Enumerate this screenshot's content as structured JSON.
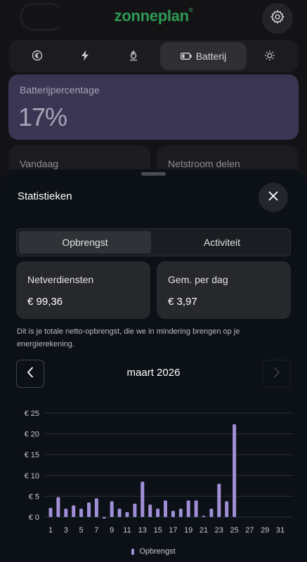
{
  "app": {
    "brand": "zonneplan",
    "brand_mark": "®"
  },
  "header": {
    "settings_icon": "gear-icon"
  },
  "tabs": [
    {
      "icon": "euro-icon",
      "label": ""
    },
    {
      "icon": "lightning-icon",
      "label": ""
    },
    {
      "icon": "flame-icon",
      "label": ""
    },
    {
      "icon": "battery-icon",
      "label": "Batterij",
      "active": true
    },
    {
      "icon": "sun-icon",
      "label": ""
    }
  ],
  "battery": {
    "label": "Batterijpercentage",
    "value": "17%"
  },
  "cards": {
    "today": "Vandaag",
    "netstroom": "Netstroom delen"
  },
  "sheet": {
    "title": "Statistieken",
    "segments": [
      {
        "label": "Opbrengst",
        "active": true
      },
      {
        "label": "Activiteit",
        "active": false
      }
    ],
    "stats": [
      {
        "label": "Netverdiensten",
        "value": "€ 99,36"
      },
      {
        "label": "Gem. per dag",
        "value": "€ 3,97"
      }
    ],
    "description": "Dit is je totale netto-opbrengst, die we in mindering brengen op je energierekening.",
    "month": "maart 2026"
  },
  "chart_data": {
    "type": "bar",
    "x": [
      1,
      2,
      3,
      4,
      5,
      6,
      7,
      8,
      9,
      10,
      11,
      12,
      13,
      14,
      15,
      16,
      17,
      18,
      19,
      20,
      21,
      22,
      23,
      24,
      25,
      26,
      27,
      28,
      29,
      30,
      31
    ],
    "values": [
      2.2,
      4.8,
      2.0,
      2.8,
      2.0,
      3.5,
      4.5,
      -0.3,
      3.8,
      2.0,
      1.2,
      3.2,
      8.5,
      3.0,
      2.0,
      4.0,
      1.5,
      2.0,
      4.0,
      4.0,
      0.3,
      2.0,
      8.0,
      3.8,
      22.3,
      0,
      0,
      0,
      0,
      0,
      0
    ],
    "xticks": [
      "1",
      "3",
      "5",
      "7",
      "9",
      "11",
      "13",
      "15",
      "17",
      "19",
      "21",
      "23",
      "25",
      "27",
      "29",
      "31"
    ],
    "yticks": [
      "€ 0",
      "€ 5",
      "€ 10",
      "€ 15",
      "€ 20",
      "€ 25"
    ],
    "ylim": [
      0,
      25
    ],
    "series_name": "Opbrengst",
    "color": "#a08fd7",
    "grid": true,
    "legend_position": "bottom"
  }
}
